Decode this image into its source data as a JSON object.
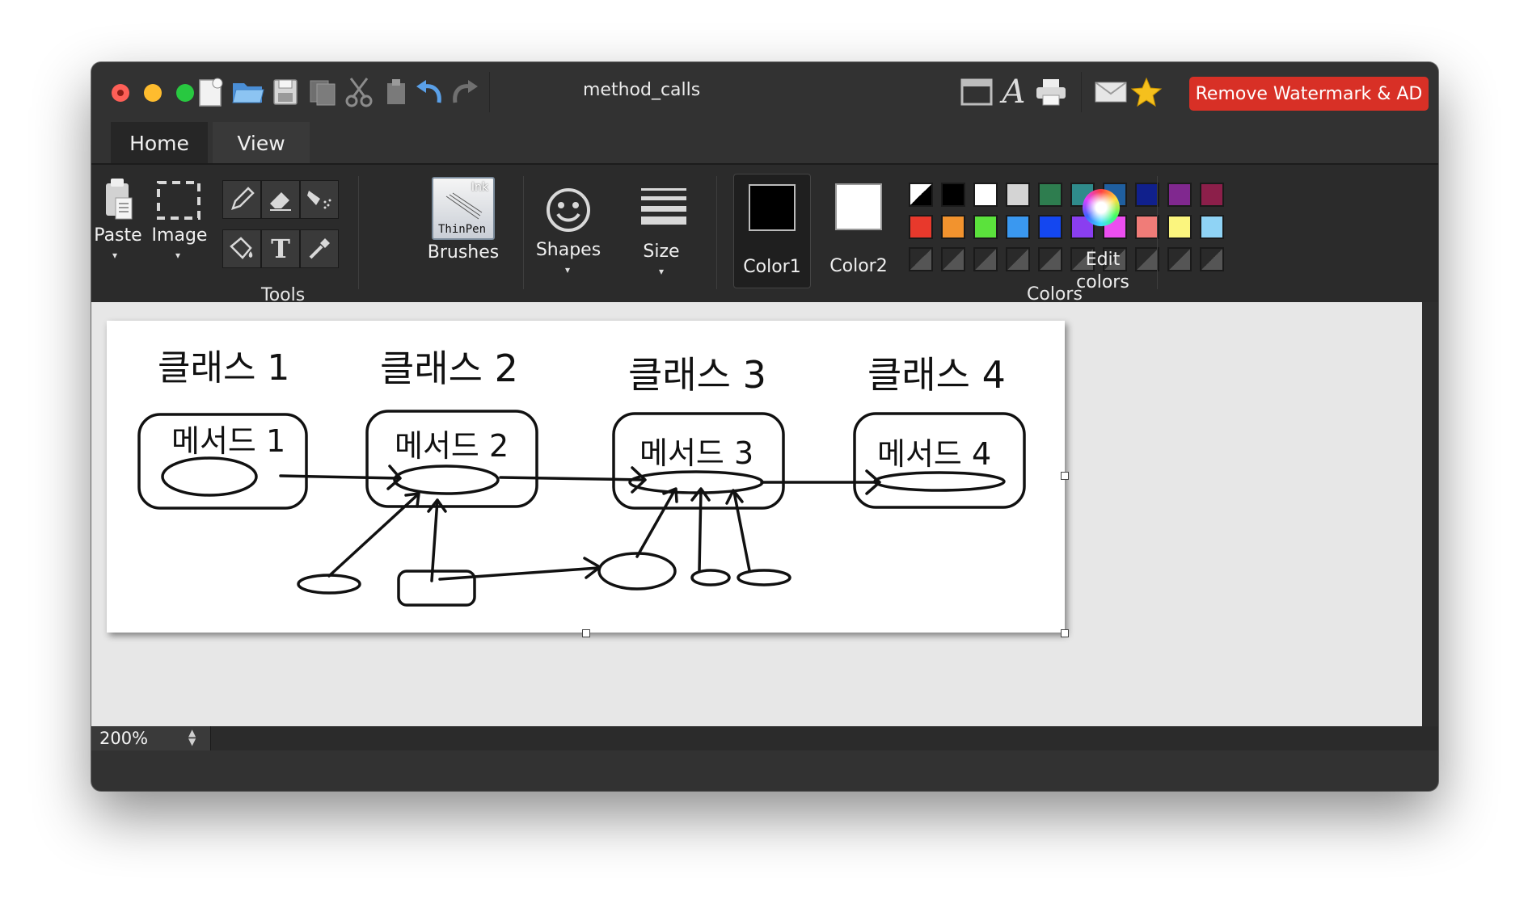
{
  "window": {
    "document_title": "method_calls",
    "watermark_button": "Remove Watermark & AD"
  },
  "tabs": [
    {
      "label": "Home"
    },
    {
      "label": "View"
    }
  ],
  "ribbon": {
    "paste": "Paste",
    "image": "Image",
    "tools_group": "Tools",
    "brushes": "Brushes",
    "brush_ink": "Ink",
    "brush_name": "ThinPen",
    "shapes": "Shapes",
    "size": "Size",
    "color1": "Color1",
    "color2": "Color2",
    "colors_group": "Colors",
    "edit_colors_line1": "Edit",
    "edit_colors_line2": "colors",
    "dropdown_arrow": "▾"
  },
  "palette": {
    "color1": "#000000",
    "color2": "#ffffff",
    "row1": [
      "#ffffff",
      "#000000",
      "#ffffff",
      "#d4d4d4",
      "#2e7d4f",
      "#2f8b8b",
      "#1f5fa0",
      "#10208c",
      "#80288f",
      "#8c1f4a"
    ],
    "row2": [
      "#e8392c",
      "#f2932e",
      "#5be23c",
      "#3a98f0",
      "#1447f0",
      "#8a3ef0",
      "#ec4ef0",
      "#f07c78",
      "#fbf57e",
      "#8fd3f5"
    ],
    "accent": "#d83026"
  },
  "drawing": {
    "classes": [
      "클래스 1",
      "클래스 2",
      "클래스 3",
      "클래스 4"
    ],
    "methods": [
      "메서드 1",
      "메서드 2",
      "메서드 3",
      "메서드 4"
    ]
  },
  "status": {
    "zoom": "200%"
  }
}
